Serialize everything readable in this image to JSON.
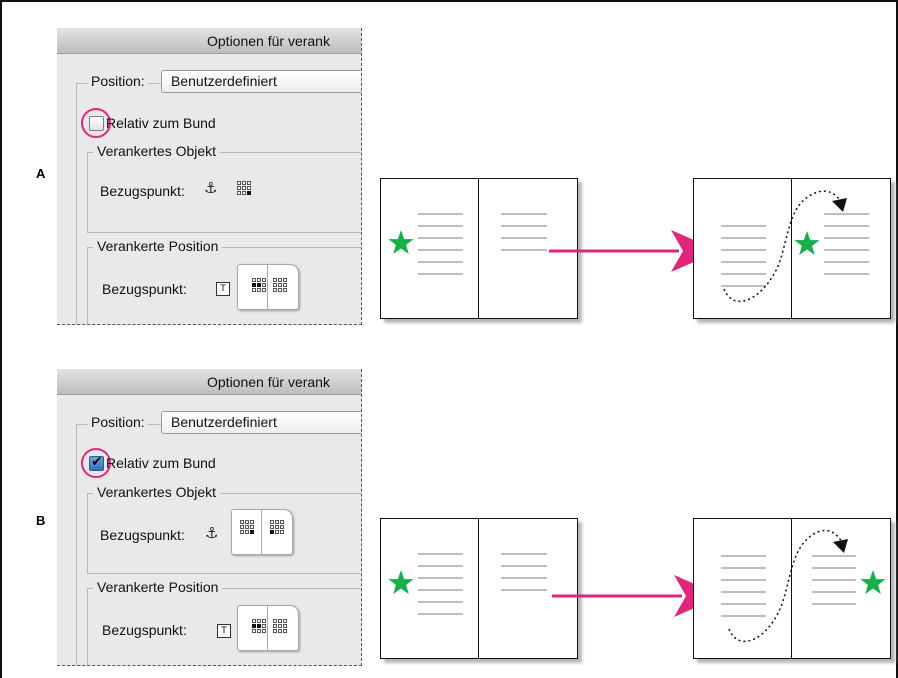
{
  "sections": [
    {
      "letter": "A",
      "dialog": {
        "title": "Optionen für verank",
        "position_label": "Position:",
        "position_value": "Benutzerdefiniert",
        "relative_label": "Relativ zum Bund",
        "relative_checked": false,
        "object_group": "Verankertes Objekt",
        "object_ref_label": "Bezugspunkt:",
        "position_group": "Verankerte Position",
        "position_ref_label": "Bezugspunkt:"
      }
    },
    {
      "letter": "B",
      "dialog": {
        "title": "Optionen für verank",
        "position_label": "Position:",
        "position_value": "Benutzerdefiniert",
        "relative_label": "Relativ zum Bund",
        "relative_checked": true,
        "object_group": "Verankertes Objekt",
        "object_ref_label": "Bezugspunkt:",
        "position_group": "Verankerte Position",
        "position_ref_label": "Bezugspunkt:"
      }
    }
  ],
  "icons": {
    "anchor": "⚓",
    "star": "star-icon",
    "flow_arrow": "arrow-right-icon"
  },
  "colors": {
    "star": "#16b04b",
    "arrow": "#e0267b",
    "highlight": "#e0267b",
    "checkbox_checked": "#2f6fbf"
  }
}
